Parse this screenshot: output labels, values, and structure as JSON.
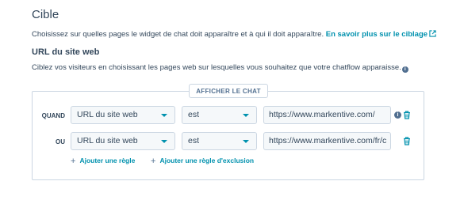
{
  "section": {
    "title": "Cible",
    "description": "Choisissez sur quelles pages le widget de chat doit apparaître et à qui il doit apparaître.",
    "learn_more": "En savoir plus sur le ciblage"
  },
  "url_section": {
    "title": "URL du site web",
    "description": "Ciblez vos visiteurs en choisissant les pages web sur lesquelles vous souhaitez que votre chatflow apparaisse."
  },
  "panel": {
    "tab_label": "AFFICHER LE CHAT",
    "rules": [
      {
        "label": "QUAND",
        "property": "URL du site web",
        "operator": "est",
        "value": "https://www.markentive.com/"
      },
      {
        "label": "OU",
        "property": "URL du site web",
        "operator": "est",
        "value": "https://www.markentive.com/fr/c"
      }
    ],
    "add_rule": "Ajouter une règle",
    "add_exclusion": "Ajouter une règle d'exclusion"
  },
  "colors": {
    "accent": "#0091ae",
    "text": "#33475b",
    "border": "#cbd6e2"
  }
}
